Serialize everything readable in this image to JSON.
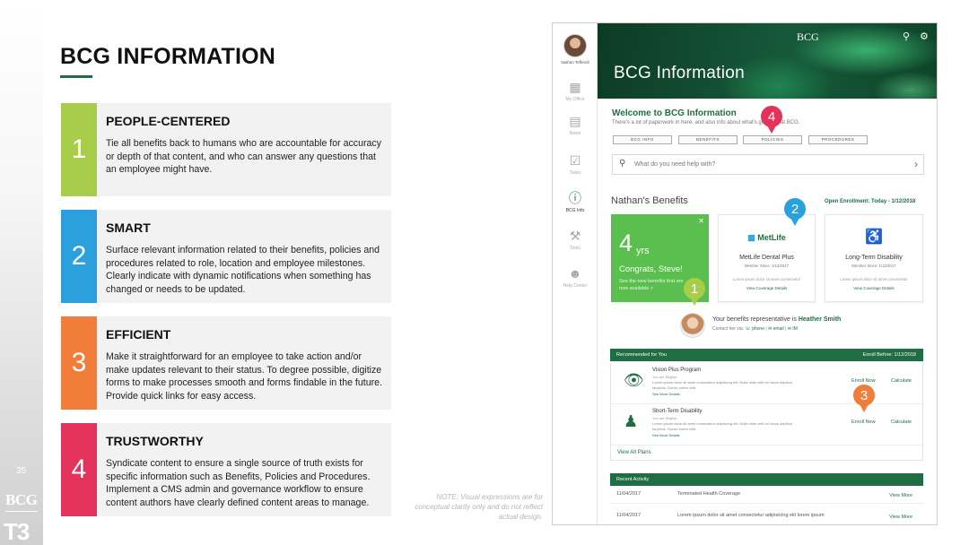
{
  "slide": {
    "title": "BCG INFORMATION",
    "page_number": "35",
    "footer_logo": "BCG",
    "footer_tag": "T3",
    "note": "NOTE: Visual expressions are for conceptual clarity only and do not reflect actual design.",
    "accent_color": "#1f6e43"
  },
  "principles": [
    {
      "number": "1",
      "title": "PEOPLE-CENTERED",
      "color": "#a8cd4b",
      "body": "Tie all benefits back to humans who are accountable for accuracy or depth of that content, and who can answer any questions that an employee might have."
    },
    {
      "number": "2",
      "title": "SMART",
      "color": "#2aa1dd",
      "body": "Surface relevant information related to their benefits, policies and procedures related to role, location and employee milestones. Clearly indicate with dynamic notifications when something has changed or needs to be updated."
    },
    {
      "number": "3",
      "title": "EFFICIENT",
      "color": "#f07d3a",
      "body": "Make it straightforward for an employee to take action and/or make updates relevant to their status. To degree possible, digitize forms to make processes smooth and forms findable in the future. Provide quick links for easy access."
    },
    {
      "number": "4",
      "title": "TRUSTWORTHY",
      "color": "#e3335b",
      "body": "Syndicate content to ensure a single source of truth exists for specific information such as Benefits, Policies and Procedures. Implement a CMS admin and governance workflow to ensure content authors have clearly defined content areas to manage."
    }
  ],
  "app": {
    "user_name": "Nathan Teffendi",
    "nav": [
      {
        "label": "My Office",
        "icon": "building-icon"
      },
      {
        "label": "News",
        "icon": "news-icon"
      },
      {
        "label": "Tasks",
        "icon": "tasks-icon"
      },
      {
        "label": "BCG Info",
        "icon": "info-icon",
        "active": true
      },
      {
        "label": "Tools",
        "icon": "tools-icon"
      },
      {
        "label": "Help Center",
        "icon": "help-icon"
      }
    ],
    "header": {
      "logo": "BCG",
      "title": "BCG Information"
    },
    "welcome": {
      "title": "Welcome to BCG Information",
      "subtitle": "There's a lot of paperwork in here, and also info about what's going on at BCG."
    },
    "tabs": [
      "BCG INFO",
      "BENEFITS",
      "POLICIES",
      "PROCEDURES"
    ],
    "search": {
      "placeholder": "What do you need help with?"
    },
    "benefits": {
      "heading": "Nathan's Benefits",
      "open_enrollment": "Open Enrollment: Today - 1/12/2018",
      "anniversary": {
        "years": "4",
        "unit": "yrs",
        "congrats": "Congrats, Steve!",
        "desc": "See the new benefits that are now available >"
      },
      "cards": [
        {
          "logo": "MetLife",
          "name": "MetLife Dental Plus",
          "since": "Member Since: 1/12/2017",
          "line": "Lorem ipsum dolor sit amet consectetur",
          "link": "View Coverage Details"
        },
        {
          "logo": "",
          "name": "Long-Term Disability",
          "since": "Member Since: 1/12/2017",
          "line": "Lorem ipsum dolor sit amet consectetur",
          "link": "View Coverage Details"
        }
      ]
    },
    "representative": {
      "prefix": "Your benefits representative is ",
      "name": "Heather Smith",
      "contact_prefix": "Contact her via:",
      "phone": "phone",
      "email": "email",
      "im": "IM"
    },
    "recommended": {
      "label": "Recommended for You",
      "deadline": "Enroll Before: 1/12/2018",
      "items": [
        {
          "icon": "eye-icon",
          "title": "Vision Plus Program",
          "sub": "You are Eligible",
          "desc": "Lorem ipsum dolor sit amet consectetur adipiscing elit. Nulla vitae velit vel lacus dapibus faucibus. Donec lorem velit.",
          "more": "See More Details",
          "enroll": "Enroll Now",
          "calc": "Calculate"
        },
        {
          "icon": "person-icon",
          "title": "Short-Term Disability",
          "sub": "You are Eligible",
          "desc": "Lorem ipsum dolor sit amet consectetur adipiscing elit. Nulla vitae velit vel lacus dapibus faucibus. Donec lorem velit.",
          "more": "See More Details",
          "enroll": "Enroll Now",
          "calc": "Calculate"
        }
      ],
      "view_all": "View All Plans"
    },
    "activity": {
      "label": "Recent Activity",
      "rows": [
        {
          "date": "11/04/2017",
          "desc": "Terminated Health Coverage",
          "action": "View More"
        },
        {
          "date": "11/04/2017",
          "desc": "Lorem ipsum dolor sit amet consectetur adipisicing elit lorem ipsum",
          "action": "View More"
        }
      ]
    },
    "callouts": [
      {
        "number": "1",
        "color": "#a8cd4b"
      },
      {
        "number": "2",
        "color": "#2aa1dd"
      },
      {
        "number": "3",
        "color": "#f07d3a"
      },
      {
        "number": "4",
        "color": "#e3335b"
      }
    ]
  }
}
